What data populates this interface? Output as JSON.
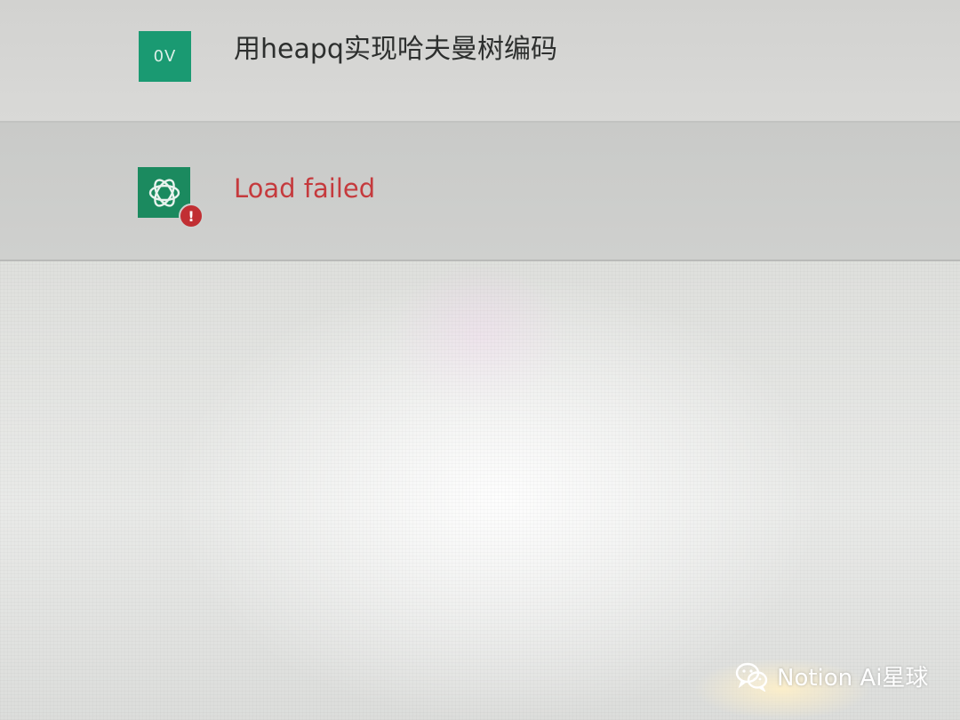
{
  "conversation": {
    "user_message": {
      "avatar_initials": "0V",
      "text": "用heapq实现哈夫曼树编码"
    },
    "assistant_message": {
      "avatar_icon": "openai-logo-icon",
      "status_icon": "error-icon",
      "status_symbol": "!",
      "text": "Load failed"
    }
  },
  "watermark": {
    "icon": "wechat-icon",
    "text": "Notion Ai星球"
  },
  "colors": {
    "user_avatar": "#1a9a72",
    "assistant_avatar": "#1b8a5f",
    "error": "#c53a3d"
  }
}
